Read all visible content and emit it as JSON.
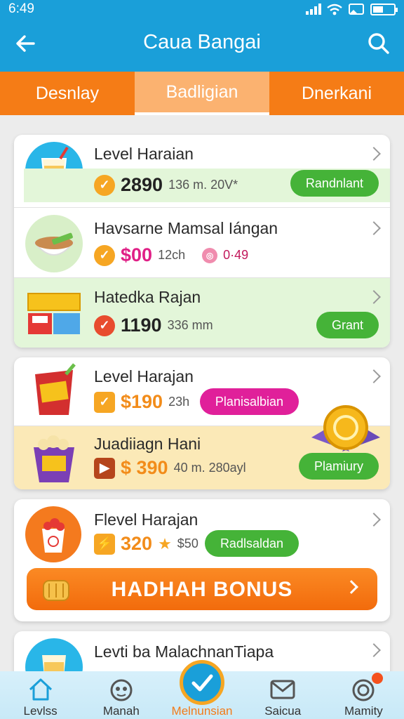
{
  "status_bar": {
    "time": "6:49"
  },
  "app_bar": {
    "title": "Caua Bangai"
  },
  "tabs": [
    {
      "label": "Desnlay",
      "active": false
    },
    {
      "label": "Badligian",
      "active": true
    },
    {
      "label": "Dnerkani",
      "active": false
    }
  ],
  "cards": [
    {
      "rows": [
        {
          "title": "Level Haraian",
          "price": "2890",
          "meta": "136 m. 20V*",
          "button": "Randnlant"
        },
        {
          "title": "Havsarne Mamsal Iángan",
          "price": "$00",
          "meta": "12ch",
          "extra": "0·49"
        },
        {
          "title": "Hatedka Rajan",
          "price": "1190",
          "meta": "336 mm",
          "button": "Grant"
        }
      ]
    },
    {
      "rows": [
        {
          "title": "Level Harajan",
          "price": "$190",
          "meta": "23h",
          "button": "Planisalbian"
        },
        {
          "title": "Juadiiagn Hani",
          "price": "$ 390",
          "meta": "40 m. 280ayl",
          "button": "Plamiury"
        }
      ]
    },
    {
      "rows": [
        {
          "title": "Flevel Harajan",
          "price": "320",
          "meta": "$50",
          "button": "Radlsaldan"
        }
      ],
      "bonus_label": "HADHAH BONUS"
    },
    {
      "rows": [
        {
          "title": "Levti ba MalachnanTiapa"
        }
      ]
    }
  ],
  "bottom_nav": [
    {
      "label": "Levlss",
      "icon": "home-icon"
    },
    {
      "label": "Manah",
      "icon": "tea-icon"
    },
    {
      "label": "Melnunsian",
      "icon": "check-icon"
    },
    {
      "label": "Saicua",
      "icon": "mail-icon"
    },
    {
      "label": "Mamity",
      "icon": "snail-icon"
    }
  ],
  "colors": {
    "primary": "#1a9fd9",
    "accent_orange": "#f57c16",
    "green": "#45b338",
    "magenta": "#e0209a",
    "price_magenta": "#e01f86",
    "price_orange": "#f28c1a"
  }
}
